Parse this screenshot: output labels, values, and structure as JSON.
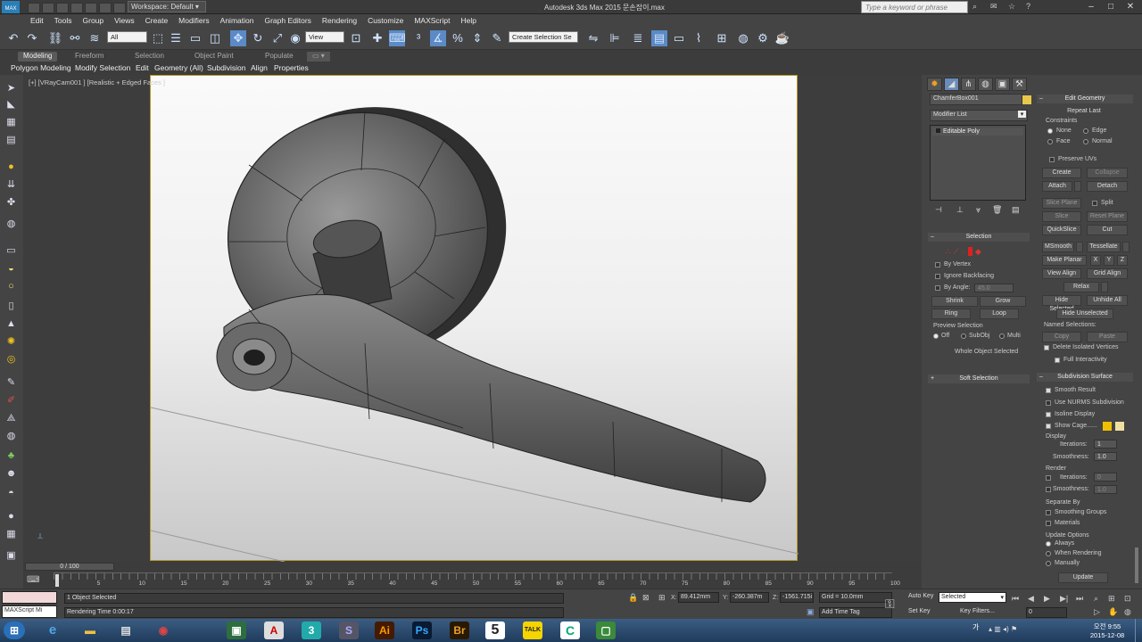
{
  "titlebar": {
    "workspace": "Workspace: Default",
    "app_title": "Autodesk 3ds Max  2015    문손잡이.max",
    "search_placeholder": "Type a keyword or phrase",
    "logo": "MAX"
  },
  "menu": [
    "Edit",
    "Tools",
    "Group",
    "Views",
    "Create",
    "Modifiers",
    "Animation",
    "Graph Editors",
    "Rendering",
    "Customize",
    "MAXScript",
    "Help"
  ],
  "toolbar": {
    "selection_filter": "All",
    "ref_coord": "View",
    "selection_set": "Create Selection Se"
  },
  "ribbon": {
    "tabs": [
      "Modeling",
      "Freeform",
      "Selection",
      "Object Paint",
      "Populate"
    ],
    "subtabs": [
      "Polygon Modeling",
      "Modify Selection",
      "Edit",
      "Geometry (All)",
      "Subdivision",
      "Align",
      "Properties"
    ]
  },
  "viewport": {
    "label": "[+] [VRayCam001 ] [Realistic + Edged Faces ]"
  },
  "command_panel": {
    "object_name": "ChamferBox001",
    "modifier_list": "Modifier List",
    "stack_item": "Editable Poly",
    "selection": {
      "title": "Selection",
      "by_vertex": "By Vertex",
      "ignore_backfacing": "Ignore Backfacing",
      "by_angle": "By Angle:",
      "angle_value": "45.0",
      "shrink": "Shrink",
      "grow": "Grow",
      "ring": "Ring",
      "loop": "Loop",
      "preview": "Preview Selection",
      "off": "Off",
      "subobj": "SubObj",
      "multi": "Multi",
      "whole": "Whole Object Selected"
    },
    "soft_selection": "Soft Selection",
    "edit_geometry": {
      "title": "Edit Geometry",
      "repeat_last": "Repeat Last",
      "constraints": "Constraints",
      "none": "None",
      "edge": "Edge",
      "face": "Face",
      "normal": "Normal",
      "preserve_uvs": "Preserve UVs",
      "create": "Create",
      "collapse": "Collapse",
      "attach": "Attach",
      "detach": "Detach",
      "slice_plane": "Slice Plane",
      "split": "Split",
      "slice": "Slice",
      "reset_plane": "Reset Plane",
      "quickslice": "QuickSlice",
      "cut": "Cut",
      "msmooth": "MSmooth",
      "tessellate": "Tessellate",
      "make_planar": "Make Planar",
      "x": "X",
      "y": "Y",
      "z": "Z",
      "view_align": "View Align",
      "grid_align": "Grid Align",
      "relax": "Relax",
      "hide_selected": "Hide Selected",
      "unhide_all": "Unhide All",
      "hide_unselected": "Hide Unselected",
      "named_selections": "Named Selections:",
      "copy": "Copy",
      "paste": "Paste",
      "delete_isolated": "Delete Isolated Vertices",
      "full_interactivity": "Full Interactivity"
    },
    "subdivision": {
      "title": "Subdivision Surface",
      "smooth_result": "Smooth Result",
      "use_nurms": "Use NURMS Subdivision",
      "isoline": "Isoline Display",
      "show_cage": "Show Cage......",
      "display": "Display",
      "iterations": "Iterations:",
      "iterations_val": "1",
      "smoothness": "Smoothness:",
      "smoothness_val": "1.0",
      "render": "Render",
      "r_iterations_val": "0",
      "r_smoothness_val": "1.0",
      "separate_by": "Separate By",
      "smoothing_groups": "Smoothing Groups",
      "materials": "Materials",
      "update_options": "Update Options",
      "always": "Always",
      "when_rendering": "When Rendering",
      "manually": "Manually",
      "update": "Update"
    },
    "colors": {
      "swatch_object": "#e8c84a",
      "cage1": "#f0c000",
      "cage2": "#f0e0a0"
    }
  },
  "timeline": {
    "slider": "0 / 100",
    "ticks": [
      "0",
      "5",
      "10",
      "15",
      "20",
      "25",
      "30",
      "35",
      "40",
      "45",
      "50",
      "55",
      "60",
      "65",
      "70",
      "75",
      "80",
      "85",
      "90",
      "95",
      "100"
    ]
  },
  "status": {
    "maxscript": "MAXScript Mi",
    "selected": "1 Object Selected",
    "render_time": "Rendering Time  0:00:17",
    "x_label": "X:",
    "x_val": "89.412mm",
    "y_label": "Y:",
    "y_val": "-260.387m",
    "z_label": "Z:",
    "z_val": "-1561.715i",
    "grid": "Grid = 10.0mm",
    "add_time_tag": "Add Time Tag",
    "auto_key": "Auto Key",
    "set_key": "Set Key",
    "key_mode": "Selected",
    "key_filters": "Key Filters...",
    "frame": "0"
  },
  "taskbar": {
    "clock_time": "오전 9:55",
    "clock_date": "2015-12-08",
    "lang": "가"
  }
}
